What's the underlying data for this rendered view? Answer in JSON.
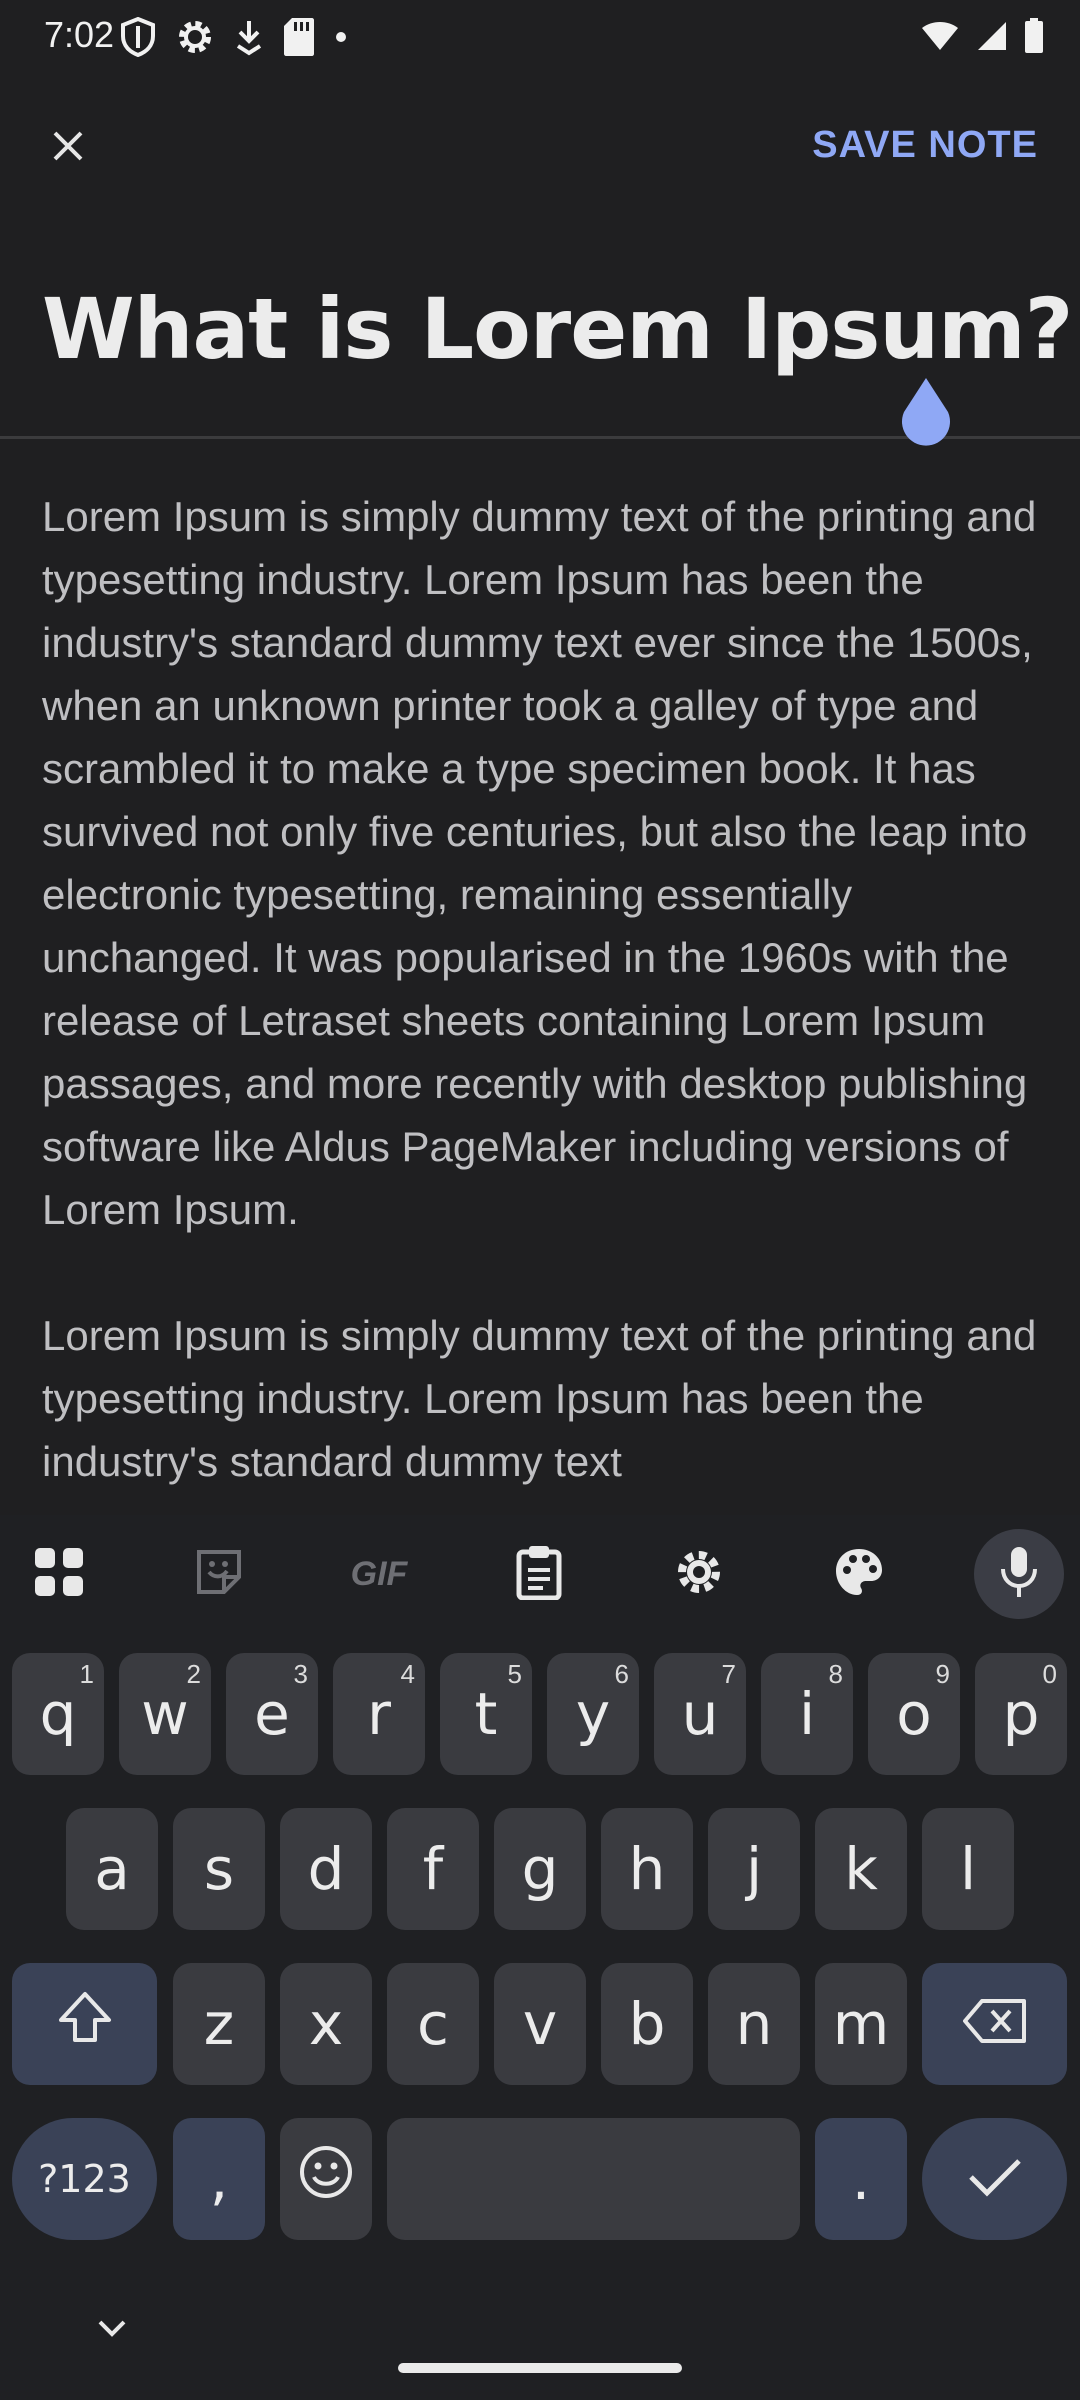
{
  "status": {
    "time": "7:02"
  },
  "appbar": {
    "save_label": "SAVE NOTE"
  },
  "note": {
    "title": "What is Lorem Ipsum?",
    "paragraphs": [
      "Lorem Ipsum is simply dummy text of the printing and typesetting industry. Lorem Ipsum has been the industry's standard dummy text ever since the 1500s, when an unknown printer took a galley of type and scrambled it to make a type specimen book. It has survived not only five centuries, but also the leap into electronic typesetting, remaining essentially unchanged. It was popularised in the 1960s with the release of Letraset sheets containing Lorem Ipsum passages, and more recently with desktop publishing software like Aldus PageMaker including versions of Lorem Ipsum.",
      "Lorem Ipsum is simply dummy text of the printing and typesetting industry. Lorem Ipsum has been the industry's standard dummy text"
    ]
  },
  "keyboard": {
    "toolbar": {
      "gif_label": "GIF"
    },
    "row1": [
      {
        "key": "q",
        "hint": "1"
      },
      {
        "key": "w",
        "hint": "2"
      },
      {
        "key": "e",
        "hint": "3"
      },
      {
        "key": "r",
        "hint": "4"
      },
      {
        "key": "t",
        "hint": "5"
      },
      {
        "key": "y",
        "hint": "6"
      },
      {
        "key": "u",
        "hint": "7"
      },
      {
        "key": "i",
        "hint": "8"
      },
      {
        "key": "o",
        "hint": "9"
      },
      {
        "key": "p",
        "hint": "0"
      }
    ],
    "row2": [
      "a",
      "s",
      "d",
      "f",
      "g",
      "h",
      "j",
      "k",
      "l"
    ],
    "row3": [
      "z",
      "x",
      "c",
      "v",
      "b",
      "n",
      "m"
    ],
    "symbols_label": "?123",
    "comma_label": ",",
    "period_label": "."
  },
  "colors": {
    "accent": "#8fa8f5",
    "background": "#1f1f21",
    "key": "#3a3b40",
    "mod_key": "#3a4257"
  },
  "icons": [
    "close-icon",
    "shield-icon",
    "gear-icon",
    "download-icon",
    "sd-card-icon",
    "wifi-icon",
    "signal-icon",
    "battery-icon",
    "apps-grid-icon",
    "sticker-icon",
    "gif-icon",
    "clipboard-icon",
    "settings-icon",
    "palette-icon",
    "mic-icon",
    "shift-icon",
    "backspace-icon",
    "emoji-icon",
    "check-icon",
    "chevron-down-icon"
  ]
}
